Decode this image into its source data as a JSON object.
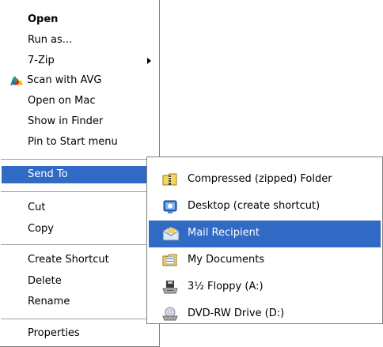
{
  "context_menu": {
    "items": [
      {
        "label": "Open"
      },
      {
        "label": "Run as..."
      },
      {
        "label": "7-Zip"
      },
      {
        "label": "Scan with AVG"
      },
      {
        "label": "Open on Mac"
      },
      {
        "label": "Show in Finder"
      },
      {
        "label": "Pin to Start menu"
      },
      {
        "label": "Send To"
      },
      {
        "label": "Cut"
      },
      {
        "label": "Copy"
      },
      {
        "label": "Create Shortcut"
      },
      {
        "label": "Delete"
      },
      {
        "label": "Rename"
      },
      {
        "label": "Properties"
      }
    ]
  },
  "send_to_submenu": {
    "items": [
      {
        "label": "Compressed (zipped) Folder",
        "icon": "zipped-folder-icon"
      },
      {
        "label": "Desktop (create shortcut)",
        "icon": "desktop-icon"
      },
      {
        "label": "Mail Recipient",
        "icon": "mail-icon"
      },
      {
        "label": "My Documents",
        "icon": "documents-folder-icon"
      },
      {
        "label": "3½ Floppy (A:)",
        "icon": "floppy-drive-icon"
      },
      {
        "label": "DVD-RW Drive (D:)",
        "icon": "dvd-drive-icon"
      }
    ]
  },
  "colors": {
    "highlight": "#316ac5",
    "highlight_text": "#ffffff",
    "border": "#7f7f7f",
    "separator": "#a0a0a0"
  }
}
